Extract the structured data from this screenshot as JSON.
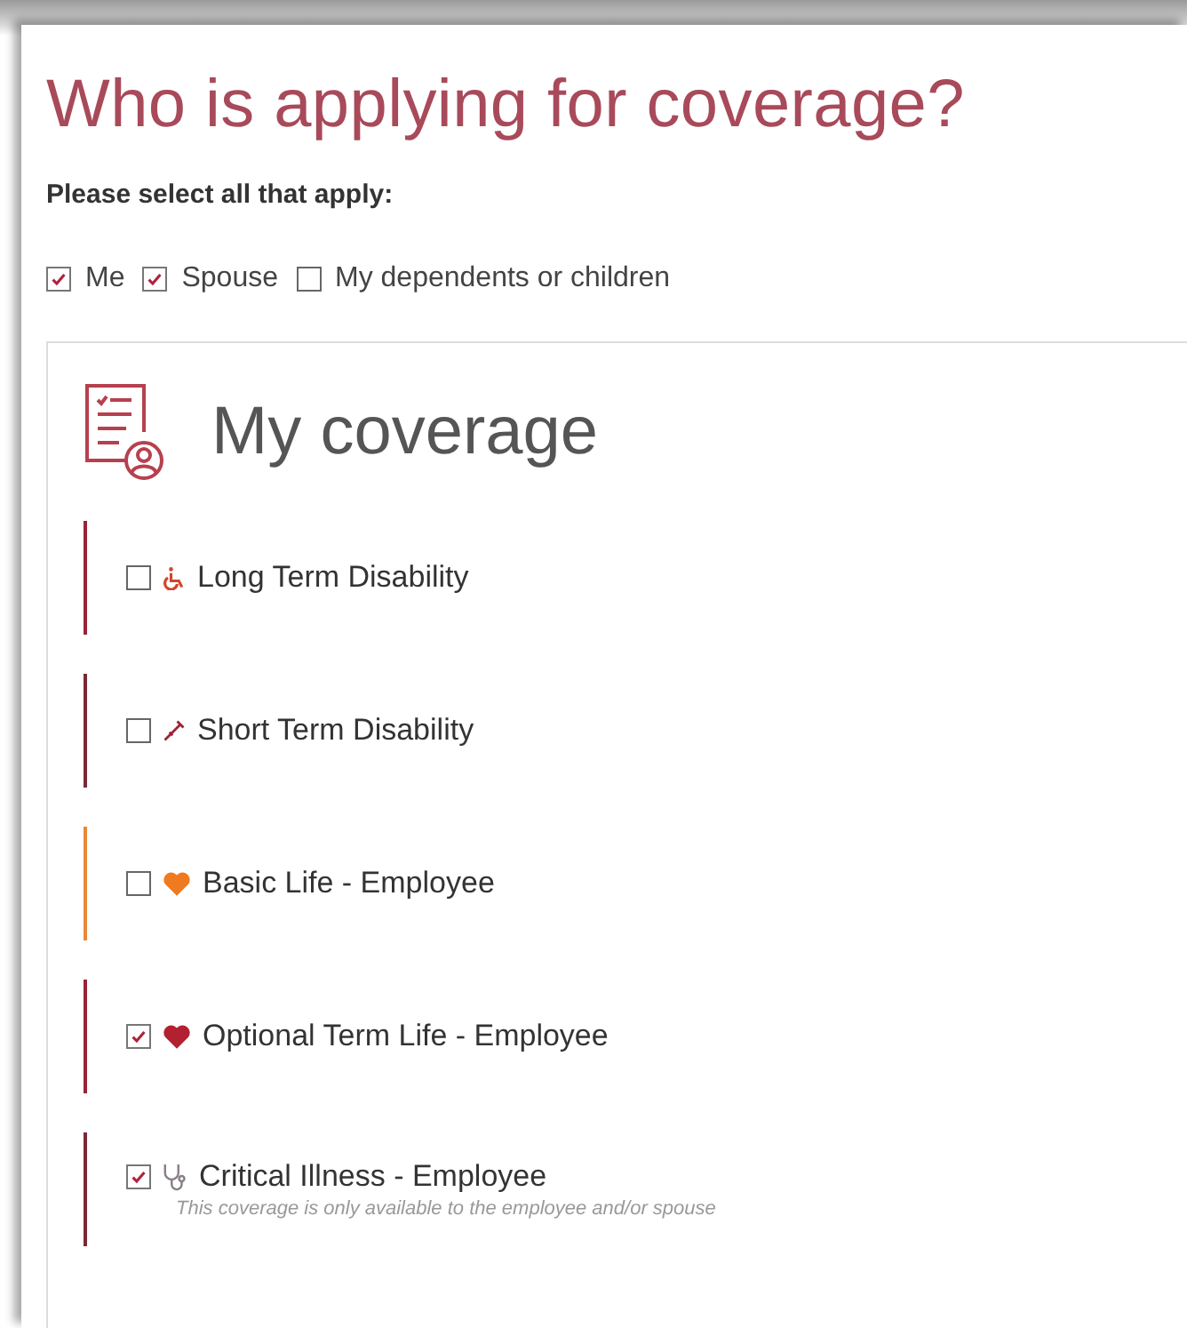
{
  "title": "Who is applying for coverage?",
  "instruction": "Please select all that apply:",
  "applicants": [
    {
      "label": "Me",
      "checked": true
    },
    {
      "label": "Spouse",
      "checked": true
    },
    {
      "label": "My dependents or children",
      "checked": false
    }
  ],
  "coverage": {
    "heading": "My coverage",
    "items": [
      {
        "label": "Long Term Disability",
        "kind": "wheelchair",
        "checked": false,
        "color": "#9b2335"
      },
      {
        "label": "Short Term Disability",
        "kind": "crutch",
        "checked": false,
        "color": "#7a2838"
      },
      {
        "label": "Basic Life - Employee",
        "kind": "basic-life",
        "checked": false,
        "color": "#e8873a"
      },
      {
        "label": "Optional Term Life - Employee",
        "kind": "optional-life",
        "checked": true,
        "color": "#9b2335"
      },
      {
        "label": "Critical Illness - Employee",
        "kind": "critical",
        "checked": true,
        "color": "#7a2838",
        "note": "This coverage is only available to the employee and/or spouse"
      }
    ]
  }
}
